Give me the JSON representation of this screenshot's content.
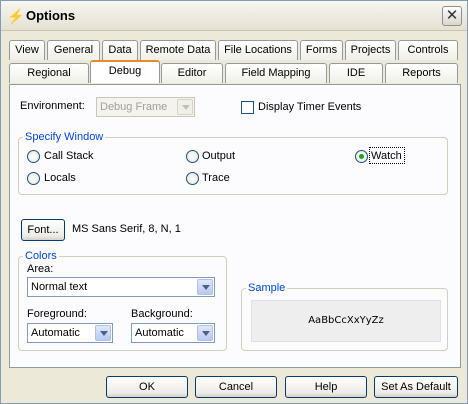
{
  "window": {
    "title": "Options"
  },
  "tabs_row1": [
    "View",
    "General",
    "Data",
    "Remote Data",
    "File Locations",
    "Forms",
    "Projects",
    "Controls"
  ],
  "tabs_row2": [
    "Regional",
    "Debug",
    "Editor",
    "Field Mapping",
    "IDE",
    "Reports"
  ],
  "active_tab": "Debug",
  "environment": {
    "label": "Environment:",
    "value": "Debug Frame"
  },
  "display_timer_events": {
    "label": "Display Timer Events",
    "checked": false
  },
  "specify_window": {
    "title": "Specify Window",
    "options": [
      "Call Stack",
      "Output",
      "Watch",
      "Locals",
      "Trace"
    ],
    "selected": "Watch"
  },
  "font": {
    "button_label": "Font...",
    "value": "MS Sans Serif, 8, N, 1"
  },
  "colors": {
    "title": "Colors",
    "area_label": "Area:",
    "area_value": "Normal text",
    "foreground_label": "Foreground:",
    "foreground_value": "Automatic",
    "background_label": "Background:",
    "background_value": "Automatic"
  },
  "sample": {
    "title": "Sample",
    "text": "AaBbCcXxYyZz"
  },
  "buttons": {
    "ok": "OK",
    "cancel": "Cancel",
    "help": "Help",
    "set_default": "Set As Default"
  }
}
